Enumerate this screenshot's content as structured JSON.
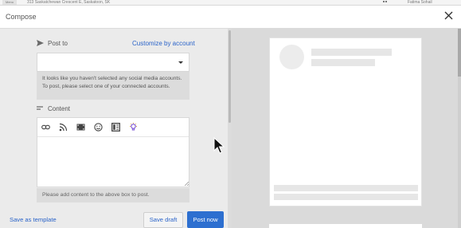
{
  "browser": {
    "tab_label": "Menu",
    "address": "313 Saskatchewan Crescent E, Saskatoon, SK",
    "user_label": "Fatima Sohail"
  },
  "header": {
    "title": "Compose",
    "close_icon": "close-icon"
  },
  "post_to": {
    "label": "Post to",
    "icon": "send-icon",
    "customize_link": "Customize by account",
    "select_value": "",
    "warning": "It looks like you haven't selected any social media accounts. To post, please select one of your connected accounts."
  },
  "content": {
    "label": "Content",
    "icon": "text-lines-icon",
    "toolbar_icons": [
      "link-icon",
      "rss-icon",
      "media-icon",
      "emoji-icon",
      "layout-icon",
      "ai-suggest-icon"
    ],
    "editor_value": "",
    "hint": "Please add content to the above box to post."
  },
  "footer": {
    "save_template": "Save as template",
    "save_draft": "Save draft",
    "post_now": "Post now"
  },
  "colors": {
    "accent": "#2b64c9",
    "primary_button": "#2d6fd0",
    "panel_bg": "#ebebeb",
    "preview_bg": "#dadada"
  }
}
